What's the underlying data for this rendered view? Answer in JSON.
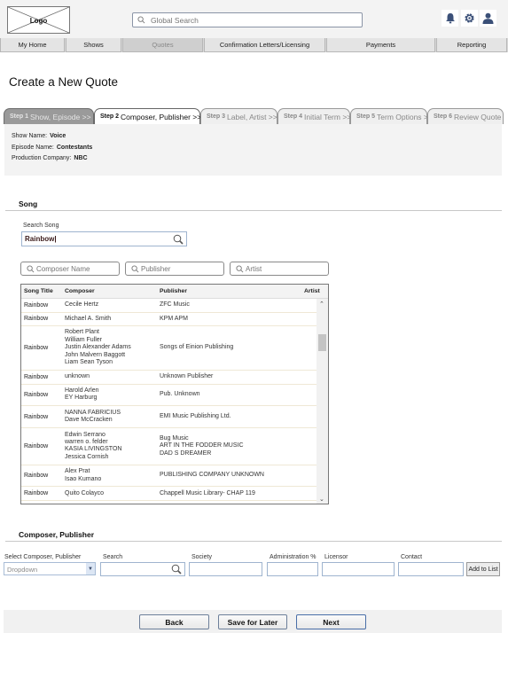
{
  "header": {
    "logo_label": "Logo",
    "search_placeholder": "Global Search",
    "icons": [
      "bell-icon",
      "gear-icon",
      "user-icon"
    ]
  },
  "nav": {
    "tabs": [
      {
        "label": "My Home",
        "active": false
      },
      {
        "label": "Shows",
        "active": false
      },
      {
        "label": "Quotes",
        "active": true
      },
      {
        "label": "Confirmation Letters/Licensing",
        "active": false
      },
      {
        "label": "Payments",
        "active": false
      },
      {
        "label": "Reporting",
        "active": false
      }
    ]
  },
  "page": {
    "title": "Create a New Quote"
  },
  "steps": [
    {
      "num": "Step 1",
      "label": "Show, Episode >>",
      "state": "done"
    },
    {
      "num": "Step 2",
      "label": "Composer, Publisher >>",
      "state": "current"
    },
    {
      "num": "Step 3",
      "label": "Label, Artist >>",
      "state": "upcoming"
    },
    {
      "num": "Step 4",
      "label": "Initial Term >>",
      "state": "upcoming"
    },
    {
      "num": "Step 5",
      "label": "Term Options >>",
      "state": "upcoming"
    },
    {
      "num": "Step 6",
      "label": "Review Quote",
      "state": "upcoming"
    }
  ],
  "info": {
    "show_label": "Show Name:",
    "show_value": "Voice",
    "episode_label": "Episode Name:",
    "episode_value": "Contestants",
    "company_label": "Production Company:",
    "company_value": "NBC"
  },
  "song": {
    "section_title": "Song",
    "search_label": "Search Song",
    "search_value": "Rainbow|",
    "filters": {
      "composer_placeholder": "Composer Name",
      "publisher_placeholder": "Publisher",
      "artist_placeholder": "Artist"
    },
    "table": {
      "columns": [
        "Song Title",
        "Composer",
        "Publisher",
        "Artist"
      ],
      "rows": [
        {
          "title": "Rainbow",
          "composer": [
            "Cecile Hertz"
          ],
          "publisher": [
            "ZFC Music"
          ],
          "artist": ""
        },
        {
          "title": "Rainbow",
          "composer": [
            "Michael A. Smith"
          ],
          "publisher": [
            "KPM APM"
          ],
          "artist": ""
        },
        {
          "title": "Rainbow",
          "composer": [
            "Robert Plant",
            "William Fuller",
            "Justin Alexander Adams",
            "John Malvern Baggott",
            "Liam Sean Tyson"
          ],
          "publisher": [
            "Songs of Einion Publishing"
          ],
          "artist": ""
        },
        {
          "title": "Rainbow",
          "composer": [
            "unknown"
          ],
          "publisher": [
            "Unknown Publisher"
          ],
          "artist": ""
        },
        {
          "title": "Rainbow",
          "composer": [
            "Harold Arlen",
            "EY Harburg"
          ],
          "publisher": [
            "Pub. Unknown"
          ],
          "artist": ""
        },
        {
          "title": "Rainbow",
          "composer": [
            "NANNA FABRICIUS",
            "Dave McCracken"
          ],
          "publisher": [
            "EMI Music Publishing Ltd."
          ],
          "artist": ""
        },
        {
          "title": "Rainbow",
          "composer": [
            "Edwin Serrano",
            "warren o. felder",
            "KASIA LIVINGSTON",
            "Jessica Cornish"
          ],
          "publisher": [
            "Bug Music",
            "ART IN THE FODDER MUSIC",
            "DAD S DREAMER"
          ],
          "artist": ""
        },
        {
          "title": "Rainbow",
          "composer": [
            "Alex Prat",
            "Isao Kumano"
          ],
          "publisher": [
            "PUBLISHING COMPANY UNKNOWN"
          ],
          "artist": ""
        },
        {
          "title": "Rainbow",
          "composer": [
            "Quito Colayco"
          ],
          "publisher": [
            "Chappell Music Library- CHAP 119"
          ],
          "artist": ""
        }
      ]
    }
  },
  "composer": {
    "section_title": "Composer, Publisher",
    "select_label": "Select Composer, Publisher",
    "select_value": "Dropdown",
    "search_label": "Search",
    "society_label": "Society",
    "admin_label": "Administration %",
    "licensor_label": "Licensor",
    "contact_label": "Contact",
    "add_button": "Add to List"
  },
  "footer": {
    "back": "Back",
    "save": "Save for Later",
    "next": "Next"
  },
  "colors": {
    "icon": "#3b5078",
    "input_border": "#9fb4cf",
    "step_done": "#9a9a9a"
  }
}
